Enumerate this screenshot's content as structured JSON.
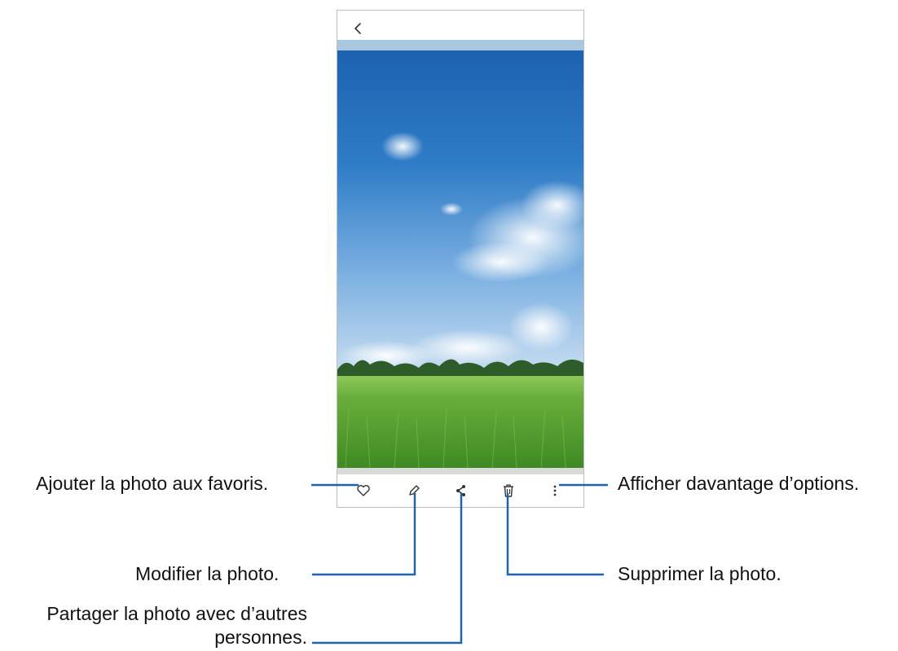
{
  "callouts": {
    "favorite": "Ajouter la photo aux favoris.",
    "edit": "Modifier la photo.",
    "share_line1": "Partager la photo avec d’autres",
    "share_line2": "personnes.",
    "more": "Afficher davantage d’options.",
    "delete": "Supprimer la photo."
  },
  "toolbar": {
    "icons": [
      "back-icon",
      "heart-icon",
      "pencil-icon",
      "share-icon",
      "trash-icon",
      "more-vertical-icon"
    ]
  },
  "colors": {
    "callout_line": "#1d64a8",
    "sky_top": "#1f66b3",
    "grass": "#5fa83a"
  }
}
